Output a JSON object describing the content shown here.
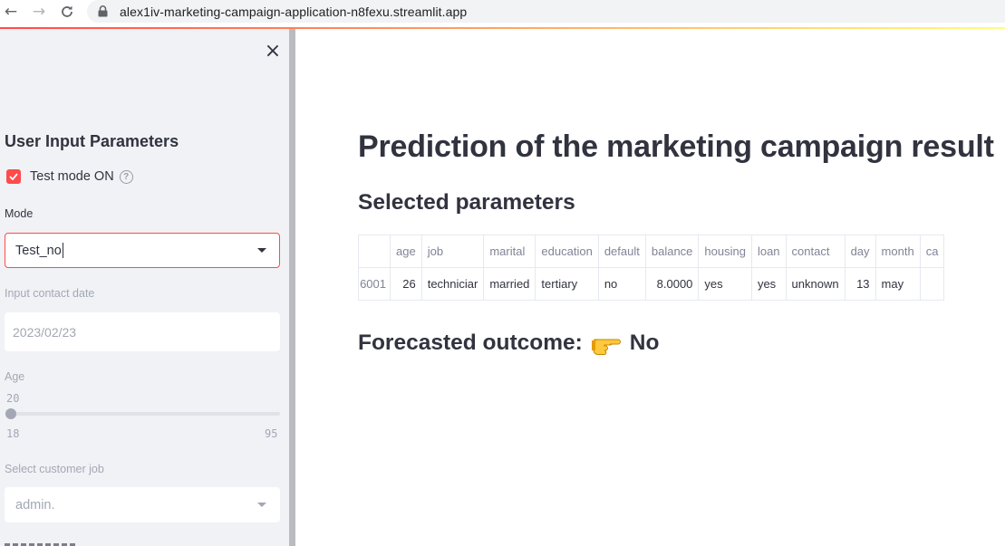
{
  "browser": {
    "url": "alex1iv-marketing-campaign-application-n8fexu.streamlit.app"
  },
  "sidebar": {
    "heading": "User Input Parameters",
    "test_mode": {
      "label": "Test mode ON",
      "checked": true
    },
    "mode": {
      "label": "Mode",
      "value": "Test_no"
    },
    "contact_date": {
      "label": "Input contact date",
      "value": "2023/02/23"
    },
    "age": {
      "label": "Age",
      "value": "20",
      "min": "18",
      "max": "95",
      "level": 0.026
    },
    "job": {
      "label": "Select customer job",
      "value": "admin."
    }
  },
  "main": {
    "title": "Prediction of the marketing campaign result",
    "subtitle": "Selected parameters",
    "table": {
      "headers": [
        "",
        "age",
        "job",
        "marital",
        "education",
        "default",
        "balance",
        "housing",
        "loan",
        "contact",
        "day",
        "month",
        "ca"
      ],
      "rows": [
        [
          "6001",
          "26",
          "techniciar",
          "married",
          "tertiary",
          "no",
          "8.0000",
          "yes",
          "yes",
          "unknown",
          "13",
          "may",
          ""
        ]
      ]
    },
    "forecast": {
      "label": "Forecasted outcome:",
      "value": "No"
    }
  },
  "colors": {
    "accent": "#ff4b4b",
    "sidebar_bg": "#f0f2f6",
    "text": "#31333f"
  }
}
